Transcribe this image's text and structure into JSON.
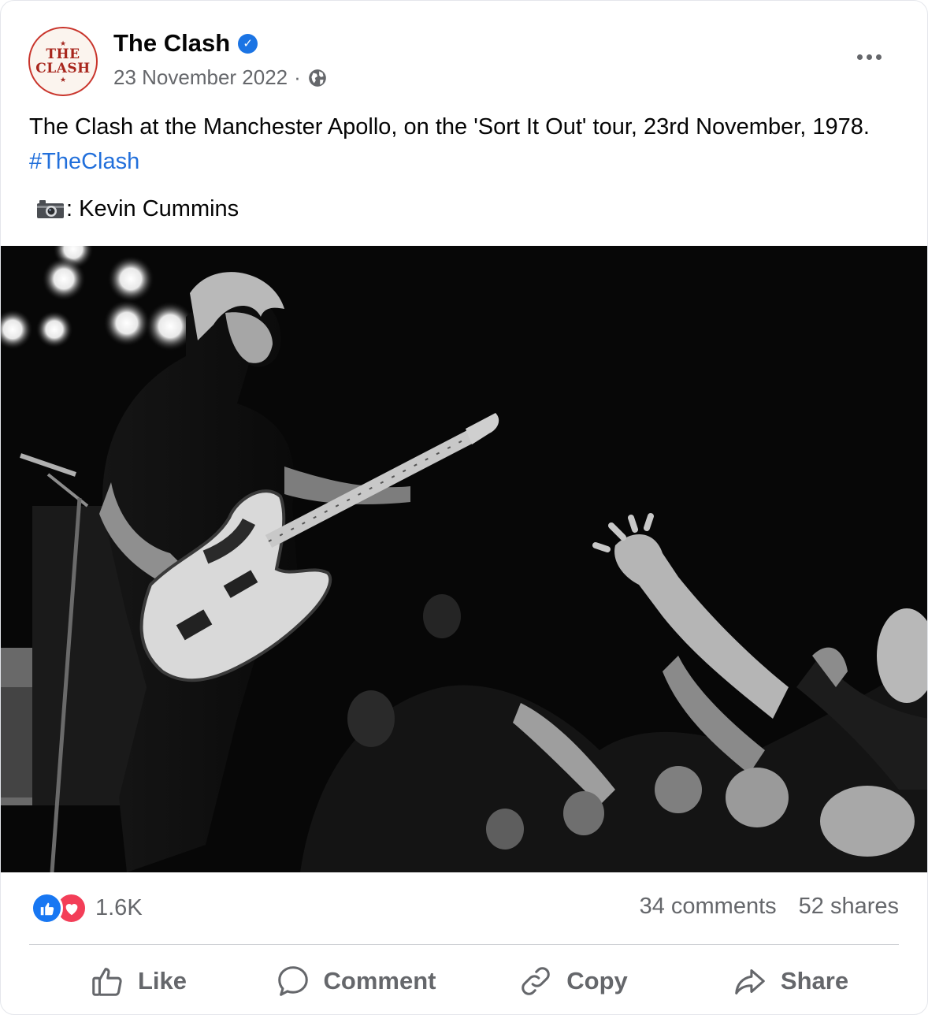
{
  "page": {
    "name": "The Clash",
    "date": "23 November 2022",
    "separator": "·",
    "avatar_text": [
      "THE",
      "CLASH"
    ],
    "verified": true
  },
  "post": {
    "text": "The Clash at the Manchester Apollo, on the 'Sort It Out' tour, 23rd November, 1978.",
    "hashtag": "#TheClash",
    "credit": ": Kevin Cummins",
    "credit_icon": "camera-icon"
  },
  "stats": {
    "reaction_count": "1.6K",
    "reactions": [
      "like",
      "love"
    ],
    "comments": "34 comments",
    "shares": "52 shares"
  },
  "actions": {
    "like": "Like",
    "comment": "Comment",
    "copy": "Copy",
    "share": "Share"
  },
  "colors": {
    "brand_blue": "#1877f2",
    "love_red": "#f33e58",
    "hashtag": "#216fdb",
    "secondary_text": "#65676b"
  }
}
